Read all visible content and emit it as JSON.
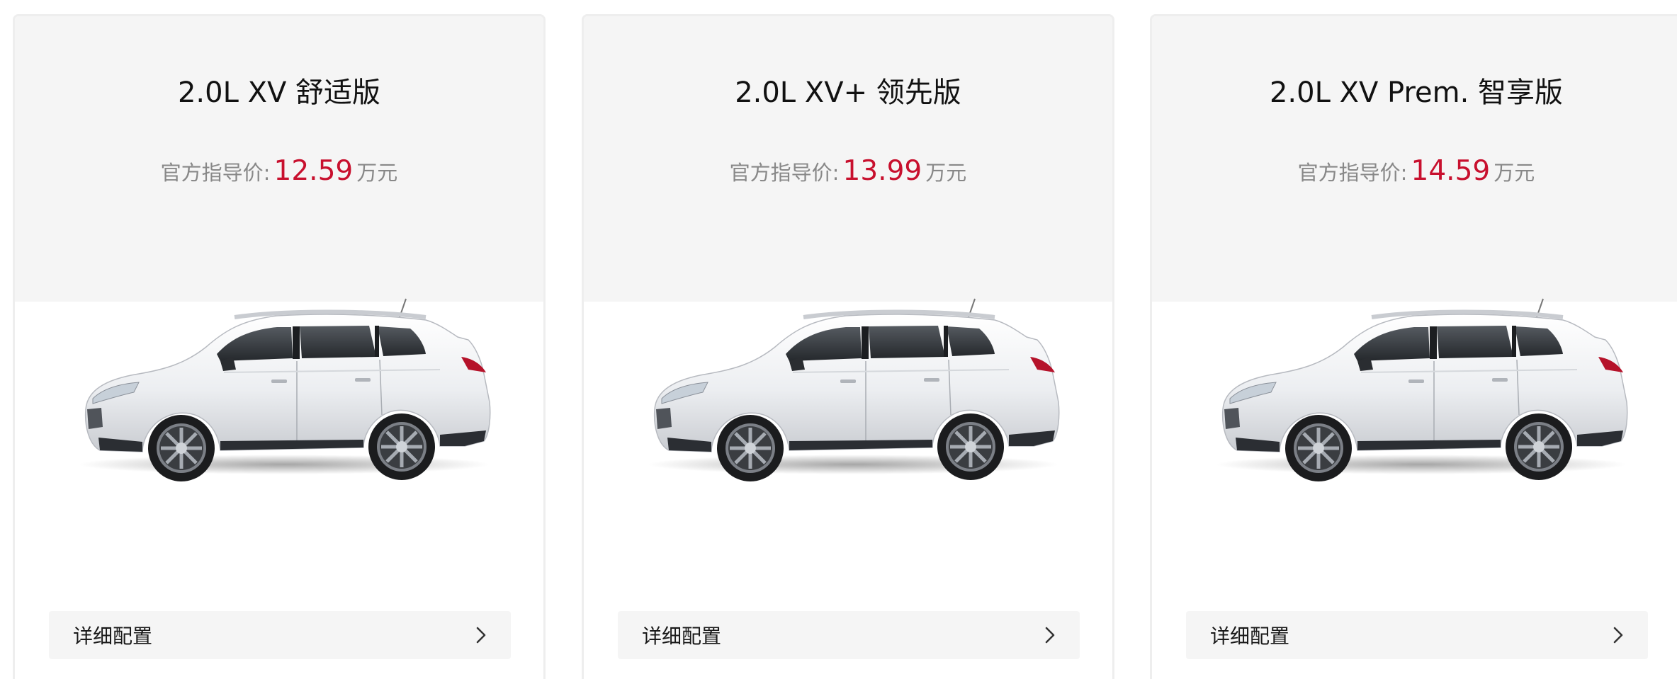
{
  "cards": [
    {
      "title": "2.0L XV 舒适版",
      "price_label": "官方指导价:",
      "price_value": "12.59",
      "price_unit": "万元",
      "details_label": "详细配置",
      "image_icon": "white-suv-side-view"
    },
    {
      "title": "2.0L XV+ 领先版",
      "price_label": "官方指导价:",
      "price_value": "13.99",
      "price_unit": "万元",
      "details_label": "详细配置",
      "image_icon": "white-suv-side-view"
    },
    {
      "title": "2.0L XV Prem. 智享版",
      "price_label": "官方指导价:",
      "price_value": "14.59",
      "price_unit": "万元",
      "details_label": "详细配置",
      "image_icon": "white-suv-side-view"
    }
  ],
  "colors": {
    "price": "#c8102e",
    "card_top_bg": "#f5f5f5",
    "button_bg": "#f5f5f5"
  }
}
